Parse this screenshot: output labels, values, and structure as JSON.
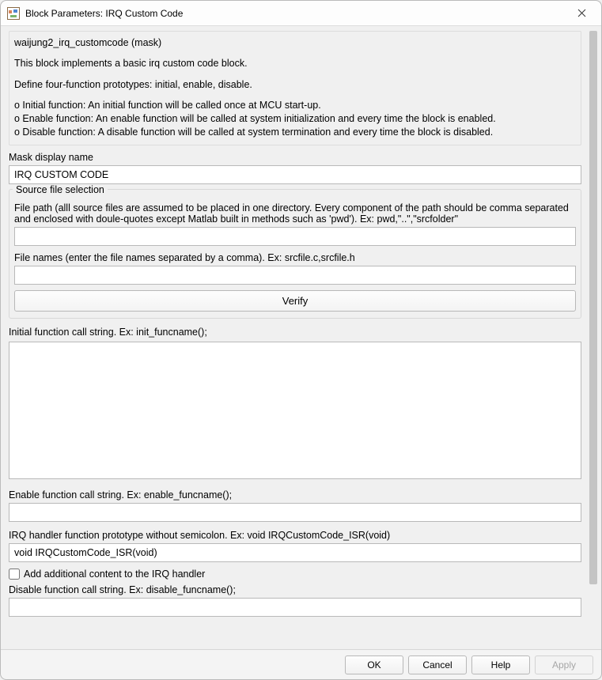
{
  "window": {
    "title": "Block Parameters: IRQ Custom Code"
  },
  "description": {
    "mask_name": "waijung2_irq_customcode (mask)",
    "line1": "This block implements a basic irq custom code block.",
    "line2": "Define four-function prototypes: initial, enable, disable.",
    "bul1": "o Initial function: An initial function will be called once at MCU start-up.",
    "bul2": "o Enable function: An enable function will be called at system initialization and every time the block is enabled.",
    "bul3": "o Disable function: A disable function will be called at system termination and every time the block is disabled."
  },
  "labels": {
    "mask_display_name": "Mask display name",
    "source_group": "Source file selection",
    "file_path": "File path (alll source files are assumed to be placed in one directory. Every component of the path should be comma separated and enclosed with doule-quotes except Matlab built in methods such as 'pwd'). Ex: pwd,\"..\",\"srcfolder\"",
    "file_names": "File names (enter the file names separated by a comma). Ex: srcfile.c,srcfile.h",
    "verify": "Verify",
    "initial_fn": "Initial function call string. Ex: init_funcname();",
    "enable_fn": "Enable function call string. Ex: enable_funcname();",
    "irq_proto": "IRQ handler function prototype without semicolon. Ex: void IRQCustomCode_ISR(void)",
    "add_content": "Add additional content to the IRQ handler",
    "disable_fn": "Disable function call string. Ex: disable_funcname();"
  },
  "values": {
    "mask_display_name": "IRQ CUSTOM CODE",
    "file_path": "",
    "file_names": "",
    "initial_fn": "",
    "enable_fn": "",
    "irq_proto": "void IRQCustomCode_ISR(void)",
    "add_content_checked": false,
    "disable_fn": ""
  },
  "buttons": {
    "ok": "OK",
    "cancel": "Cancel",
    "help": "Help",
    "apply": "Apply"
  }
}
